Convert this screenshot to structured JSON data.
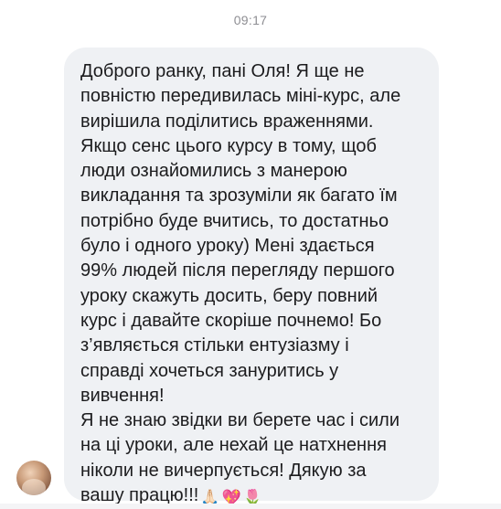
{
  "timestamp": "09:17",
  "message": {
    "lines": [
      "Доброго ранку, пані Оля! Я ще не",
      "повністю передивилась міні-курс, але",
      "вирішила поділитись враженнями.",
      "Якщо сенс цього курсу в тому, щоб",
      "люди ознайомились з манерою",
      "викладання та зрозуміли як багато їм",
      "потрібно буде вчитись, то достатньо",
      "було і одного уроку) Мені здається",
      "99% людей після перегляду першого",
      "уроку скажуть досить, беру повний",
      "курс і давайте скоріше почнемо! Бо",
      "з’являється стільки ентузіазму і",
      "справді хочеться зануритись у",
      "вивчення!",
      "Я не знаю звідки ви берете час і сили",
      "на ці уроки, але нехай це натхнення",
      "ніколи не  вичерпується! Дякую за",
      "вашу працю!!!"
    ],
    "emojis": [
      "🙏🏻",
      "💖",
      "🌷"
    ]
  },
  "sender": {
    "avatar_icon": "user-avatar-photo"
  },
  "colors": {
    "bubble_bg": "#eff1f4",
    "text": "#1c1c1e",
    "timestamp": "#8e8e93"
  }
}
